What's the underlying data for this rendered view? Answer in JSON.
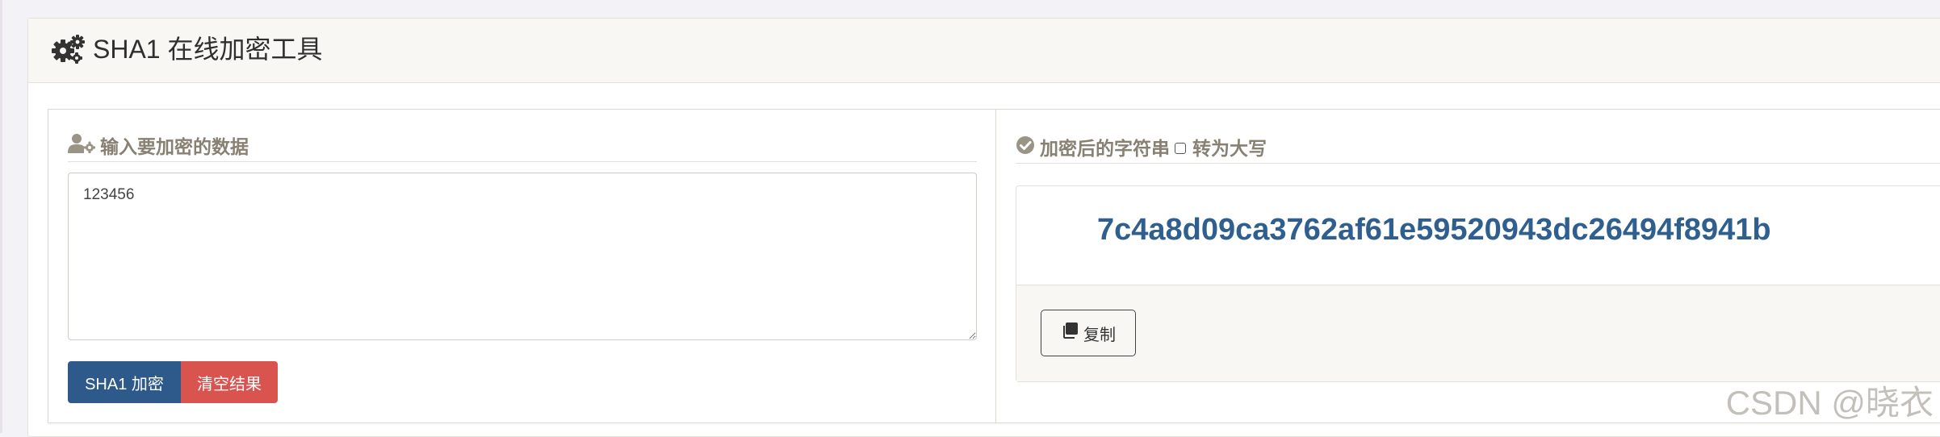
{
  "panel": {
    "title": "SHA1 在线加密工具",
    "icon": "gears-icon"
  },
  "input_section": {
    "legend": "输入要加密的数据",
    "legend_icon": "user-gear-icon",
    "value": "123456",
    "encrypt_button": "SHA1 加密",
    "clear_button": "清空结果"
  },
  "output_section": {
    "legend": "加密后的字符串",
    "legend_icon": "check-circle-icon",
    "uppercase_label": "转为大写",
    "uppercase_checked": false,
    "result": "7c4a8d09ca3762af61e59520943dc26494f8941b",
    "copy_button": "复制",
    "copy_icon": "copy-icon"
  },
  "watermark": "CSDN @晓衣",
  "colors": {
    "primary": "#2e5a8b",
    "danger": "#d9534f",
    "hash_text": "#2f5f8f",
    "legend_text": "#888173"
  }
}
